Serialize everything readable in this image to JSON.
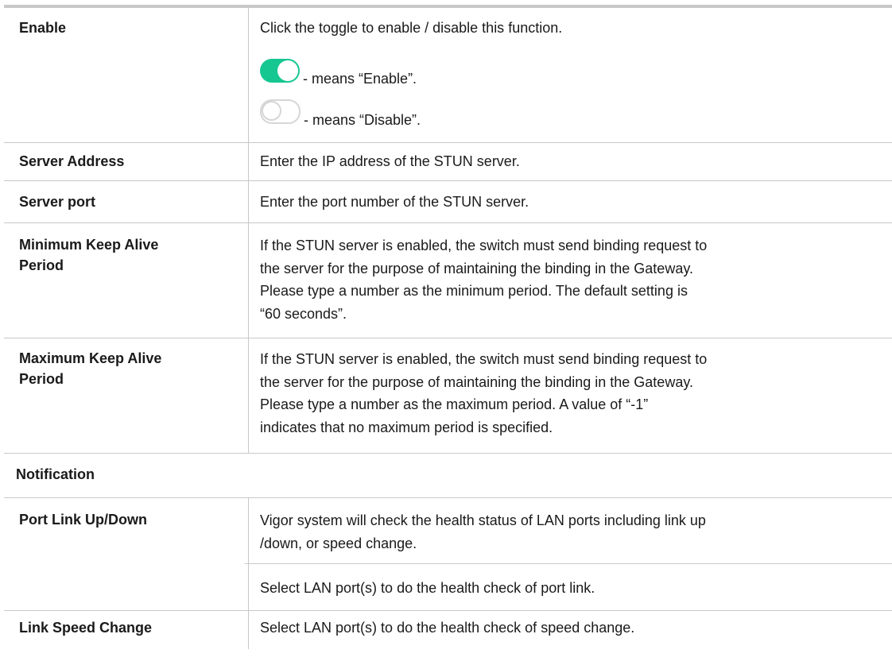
{
  "rows": {
    "enable": {
      "term": "Enable",
      "desc": "Click the toggle to enable / disable this function.",
      "toggle_on_text": "- means “Enable”.",
      "toggle_off_text": "- means “Disable”."
    },
    "server_address": {
      "term": "Server Address",
      "desc": "Enter the IP address of the STUN server."
    },
    "server_port": {
      "term": "Server port",
      "desc": "Enter the port number of the STUN server."
    },
    "min_keep_alive": {
      "term_line1": "Minimum Keep Alive",
      "term_line2": "Period",
      "desc_lines": [
        "If the STUN server is enabled, the switch must send binding request to",
        "the server for the purpose of maintaining the binding in the Gateway.",
        "Please type a number as the minimum period. The default setting is",
        "“60 seconds”."
      ]
    },
    "max_keep_alive": {
      "term_line1": "Maximum Keep Alive",
      "term_line2": "Period",
      "desc_lines": [
        "If the STUN server is enabled, the switch must send binding request to",
        "the server for the purpose of maintaining the binding in the Gateway.",
        "Please type a number as the maximum period. A value of “-1”",
        "indicates that no maximum period is specified."
      ]
    },
    "notification": {
      "heading": "Notification"
    },
    "port_link": {
      "term": "Port Link Up/Down",
      "desc_lines": [
        "Vigor system will check the health status of LAN ports including link up",
        "/down, or speed change."
      ],
      "desc2": "Select LAN port(s) to do the health check of port link."
    },
    "link_speed": {
      "term": "Link Speed Change",
      "desc": "Select LAN port(s) to do the health check of speed change."
    }
  },
  "colors": {
    "toggle_on": "#16c792",
    "border": "#c8c8c8"
  },
  "icons": {
    "toggle_on": "toggle-on-icon",
    "toggle_off": "toggle-off-icon"
  }
}
